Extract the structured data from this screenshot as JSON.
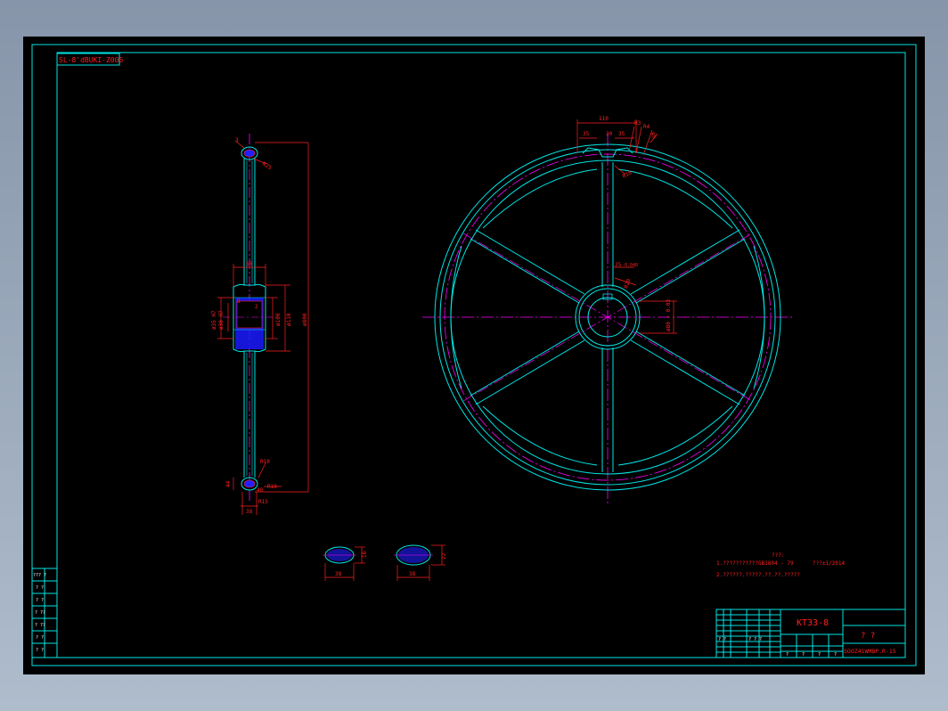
{
  "colors": {
    "background": "#000000",
    "frame": "#00e5e5",
    "dimension": "#ff2020",
    "centerline": "#ff00ff",
    "white_text": "#ffffff"
  },
  "drawing": {
    "stamp_label": "SL-8'dBUKI-Z006",
    "title_code": "KT33-8",
    "title_marks": "? ?",
    "drawing_number": "SOOZ41WMBP.R-15",
    "title_small_left": "? ?",
    "title_small_mid": "? ? ?",
    "title_scale_cells": [
      "?",
      "?",
      "?",
      "?"
    ]
  },
  "notes": {
    "heading": "???:",
    "line1": "1.???????????GB1804 - 79",
    "line1_right": "???±1/2014",
    "line2": "2.??????.?????.??.??.?????"
  },
  "section_view": {
    "dims": {
      "top_small": "3",
      "top_chamfer": "R25",
      "hub_width": "56",
      "bore_left_a": "ø35 H7",
      "bore_left_b": "ø30 H7",
      "key_mark": "8",
      "key_mark2": "2",
      "hub_dia_a": "ø100",
      "hub_dia_b": "ø110",
      "overall_dia": "ø800",
      "rim_r": "R10",
      "rim_h": "44",
      "rim_r2": "R10",
      "rim_w": "R15",
      "base_w": "38",
      "rim_side": "40"
    }
  },
  "front_view": {
    "dims": {
      "top_total": "110",
      "top_left": "35",
      "top_mid": "35",
      "top_small": "30",
      "top_r1": "R3",
      "top_r2": "R4",
      "top_r3": "R5",
      "notch_r": "R18",
      "key_width": "25",
      "key_tol": "-0.040",
      "key_depth": "R20",
      "bore_dim": "ø80 + 0.03"
    }
  },
  "spoke_sections": {
    "left": {
      "w": "38",
      "h": "16"
    },
    "right": {
      "w": "38",
      "h": "22"
    }
  },
  "sidebar_rows": [
    "??? ?",
    "? ?",
    "? ?",
    "? ??",
    "? ??",
    "? ?",
    "? ?"
  ]
}
